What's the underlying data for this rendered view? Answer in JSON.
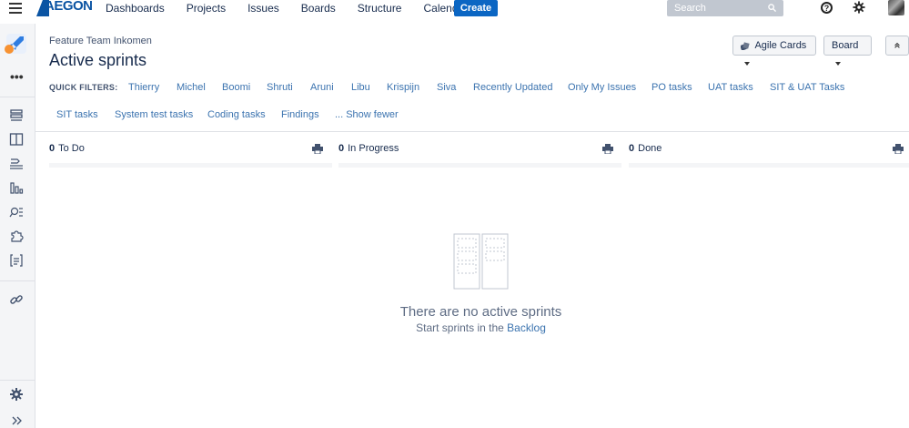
{
  "topnav": {
    "logo_text": "AEGON",
    "items": [
      "Dashboards",
      "Projects",
      "Issues",
      "Boards",
      "Structure",
      "Calendar"
    ],
    "create_label": "Create",
    "search_placeholder": "Search"
  },
  "header": {
    "breadcrumb": "Feature Team Inkomen",
    "title": "Active sprints",
    "agile_cards_label": "Agile Cards",
    "board_label": "Board"
  },
  "quick_filters": {
    "label": "QUICK FILTERS:",
    "row1": [
      "Thierry",
      "Michel",
      "Boomi",
      "Shruti",
      "Aruni",
      "Libu",
      "Krispijn",
      "Siva",
      "Recently Updated",
      "Only My Issues",
      "PO tasks",
      "UAT tasks",
      "SIT & UAT Tasks"
    ],
    "row2": [
      "SIT tasks",
      "System test tasks",
      "Coding tasks",
      "Findings",
      "... Show fewer"
    ]
  },
  "columns": [
    {
      "count": "0",
      "name": "To Do"
    },
    {
      "count": "0",
      "name": "In Progress"
    },
    {
      "count": "0",
      "name": "Done"
    }
  ],
  "empty_state": {
    "title": "There are no active sprints",
    "subtitle_prefix": "Start sprints in the ",
    "subtitle_link": "Backlog"
  },
  "colors": {
    "brand": "#0b54a3",
    "create": "#0b66c3",
    "link": "#3b73af",
    "sidebar_bg": "#f4f5f7"
  }
}
